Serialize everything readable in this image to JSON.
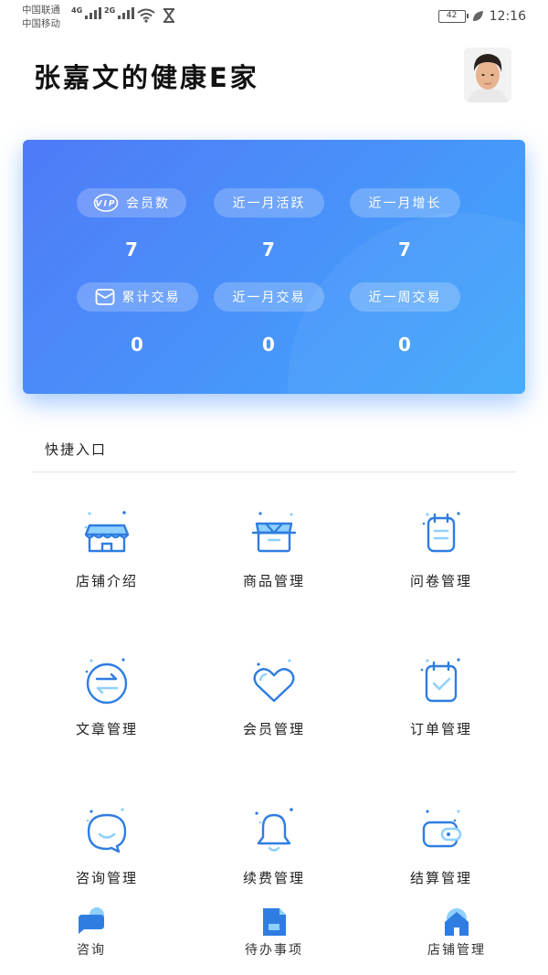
{
  "status_bar": {
    "carrier_1": "中国联通",
    "carrier_2": "中国移动",
    "net_1": "4G",
    "net_2": "2G",
    "battery": "42",
    "time": "12:16"
  },
  "header": {
    "title": "张嘉文的健康E家",
    "avatar_icon": "user-avatar"
  },
  "stats": {
    "vip_badge": "VIP",
    "items": [
      {
        "label": "会员数",
        "value": "7",
        "icon": "vip-icon"
      },
      {
        "label": "近一月活跃",
        "value": "7"
      },
      {
        "label": "近一月增长",
        "value": "7"
      },
      {
        "label": "累计交易",
        "value": "0",
        "icon": "mail-icon"
      },
      {
        "label": "近一月交易",
        "value": "0"
      },
      {
        "label": "近一周交易",
        "value": "0"
      }
    ]
  },
  "quick_entry": {
    "title": "快捷入口",
    "items": [
      {
        "label": "店铺介绍",
        "icon": "shop-icon"
      },
      {
        "label": "商品管理",
        "icon": "goods-box-icon"
      },
      {
        "label": "问卷管理",
        "icon": "questionnaire-icon"
      },
      {
        "label": "文章管理",
        "icon": "article-exchange-icon"
      },
      {
        "label": "会员管理",
        "icon": "heart-icon"
      },
      {
        "label": "订单管理",
        "icon": "order-calendar-icon"
      },
      {
        "label": "咨询管理",
        "icon": "chat-bubble-icon"
      },
      {
        "label": "续费管理",
        "icon": "bell-icon"
      },
      {
        "label": "结算管理",
        "icon": "wallet-icon"
      }
    ]
  },
  "bottom_nav": {
    "items": [
      {
        "label": "咨询",
        "icon": "chat-icon"
      },
      {
        "label": "待办事项",
        "icon": "document-icon"
      },
      {
        "label": "店铺管理",
        "icon": "store-home-icon"
      }
    ]
  },
  "colors": {
    "accent": "#2f7de1",
    "card_gradient_start": "#4f7af8",
    "card_gradient_end": "#3fa9fb",
    "icon_light": "#8fd0ff"
  }
}
